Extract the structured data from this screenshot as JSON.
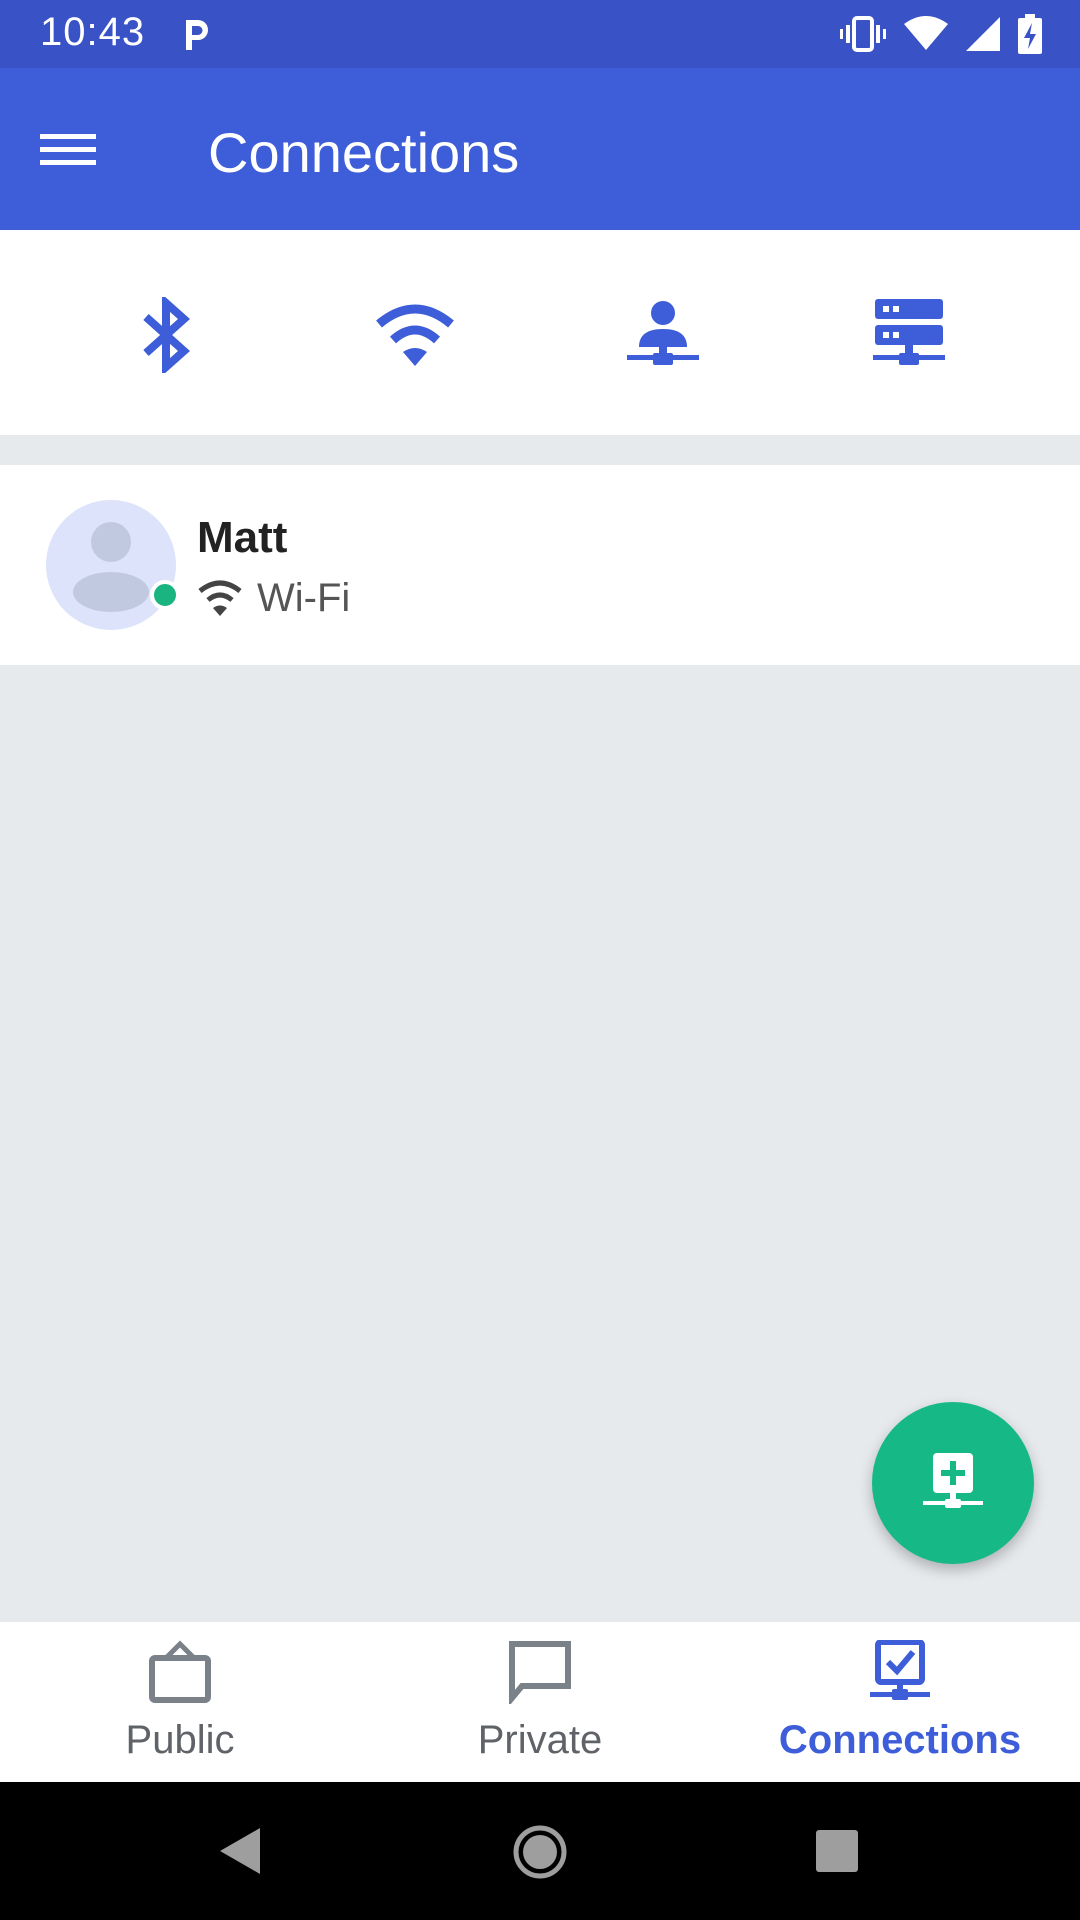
{
  "status_bar": {
    "time": "10:43",
    "icons": [
      "parking-notification-icon",
      "vibrate-icon",
      "wifi-signal-icon",
      "cell-signal-icon",
      "battery-charging-icon"
    ]
  },
  "app_bar": {
    "title": "Connections",
    "menu_icon": "hamburger-menu-icon"
  },
  "connection_types": [
    {
      "icon": "bluetooth-icon"
    },
    {
      "icon": "wifi-icon"
    },
    {
      "icon": "person-network-icon"
    },
    {
      "icon": "server-network-icon"
    }
  ],
  "contacts": [
    {
      "name": "Matt",
      "connection": "Wi-Fi",
      "status": "online"
    }
  ],
  "fab": {
    "icon": "add-connection-icon"
  },
  "bottom_nav": {
    "items": [
      {
        "label": "Public",
        "icon": "bag-icon",
        "active": false
      },
      {
        "label": "Private",
        "icon": "chat-bubble-icon",
        "active": false
      },
      {
        "label": "Connections",
        "icon": "connections-check-icon",
        "active": true
      }
    ]
  },
  "colors": {
    "status_bar": "#3952c6",
    "app_bar": "#3d5dd9",
    "accent": "#3d5dd9",
    "fab": "#16b985",
    "online": "#19b47f",
    "background": "#e7eaed"
  }
}
